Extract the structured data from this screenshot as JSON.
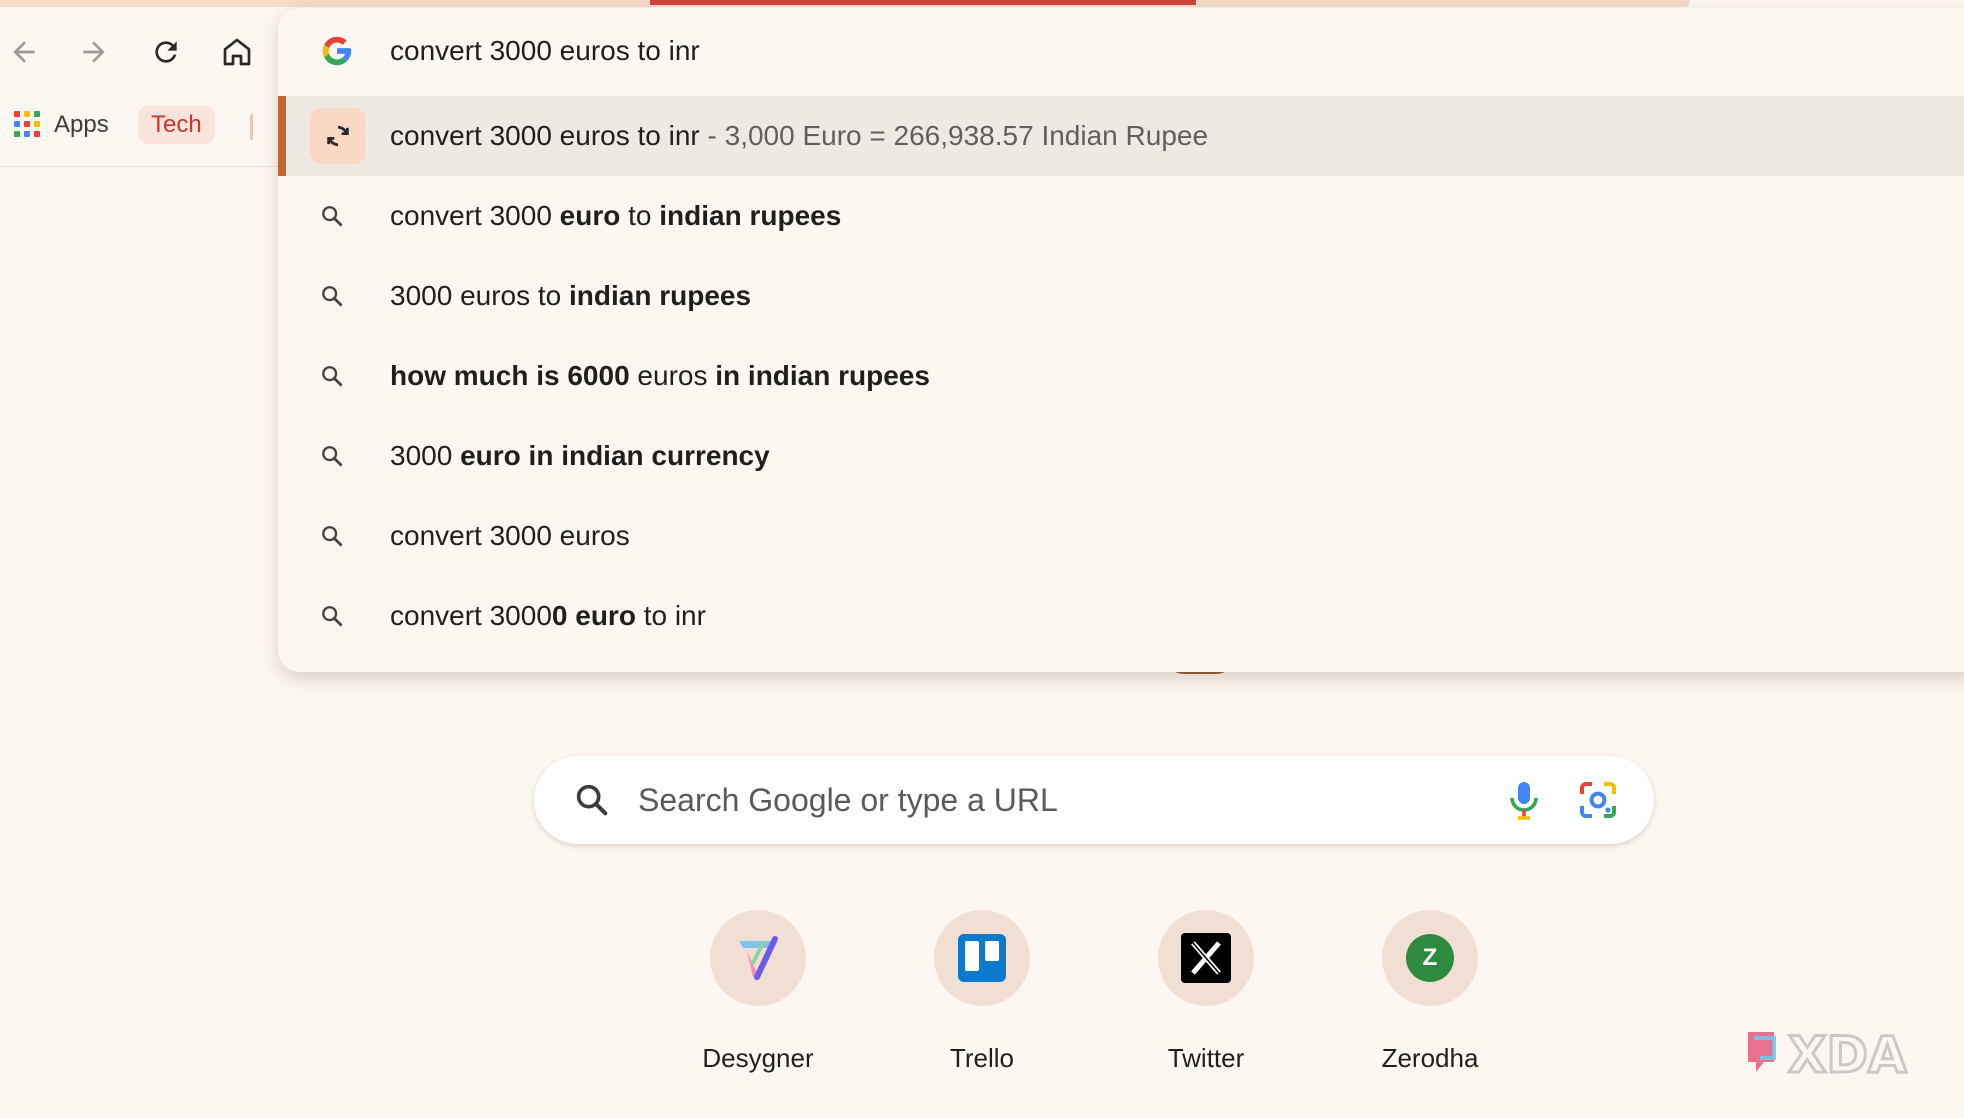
{
  "toolbar": {
    "back_icon": "arrow-left-icon",
    "forward_icon": "arrow-right-icon",
    "reload_icon": "reload-icon",
    "home_icon": "home-icon"
  },
  "bookmarks": {
    "apps_label": "Apps",
    "tech_label": "Tech"
  },
  "omnibox": {
    "query": "convert 3000 euros to inr",
    "suggestions": [
      {
        "type": "answer",
        "icon": "currency-convert-icon",
        "text": "convert 3000 euros to inr",
        "answer": " - 3,000 Euro = 266,938.57 Indian Rupee",
        "selected": true
      },
      {
        "type": "search",
        "icon": "search-icon",
        "parts": [
          [
            "convert 3000 ",
            false
          ],
          [
            "euro",
            true
          ],
          [
            " to ",
            false
          ],
          [
            "indian rupees",
            true
          ]
        ]
      },
      {
        "type": "search",
        "icon": "search-icon",
        "parts": [
          [
            "3000 euros to ",
            false
          ],
          [
            "indian rupees",
            true
          ]
        ]
      },
      {
        "type": "search",
        "icon": "search-icon",
        "parts": [
          [
            "how much is 6000",
            true
          ],
          [
            " euros ",
            false
          ],
          [
            "in indian rupees",
            true
          ]
        ]
      },
      {
        "type": "search",
        "icon": "search-icon",
        "parts": [
          [
            "3000 ",
            false
          ],
          [
            "euro in indian currency",
            true
          ]
        ]
      },
      {
        "type": "search",
        "icon": "search-icon",
        "parts": [
          [
            "convert 3000 euros",
            false
          ]
        ]
      },
      {
        "type": "search",
        "icon": "search-icon",
        "parts": [
          [
            "convert 3000",
            false
          ],
          [
            "0 euro",
            true
          ],
          [
            " to inr",
            false
          ]
        ]
      }
    ]
  },
  "search": {
    "placeholder": "Search Google or type a URL"
  },
  "shortcuts": [
    {
      "label": "Desygner",
      "icon": "desygner-icon"
    },
    {
      "label": "Trello",
      "icon": "trello-icon"
    },
    {
      "label": "Twitter",
      "icon": "x-twitter-icon"
    },
    {
      "label": "Zerodha",
      "icon": "zerodha-icon",
      "icon_letter": "Z"
    }
  ],
  "watermark": {
    "text": "XDA"
  },
  "colors": {
    "accent": "#c06a2c",
    "progress": "#d0453b",
    "tech_text": "#c7372e"
  }
}
